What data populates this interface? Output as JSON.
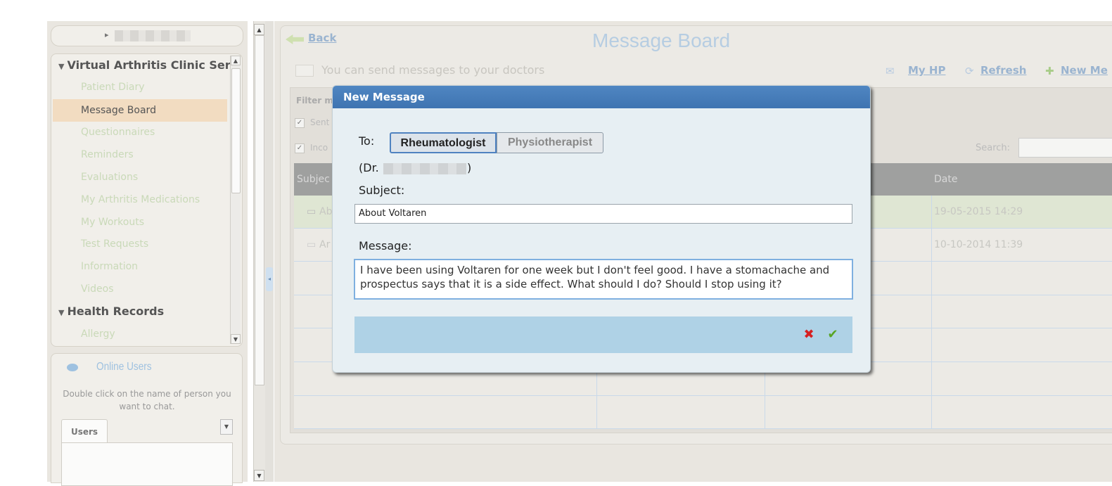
{
  "sidebar": {
    "header_virtual": "Virtual Arthritis Clinic Ser",
    "items": [
      {
        "label": "Patient Diary"
      },
      {
        "label": "Message Board"
      },
      {
        "label": "Questionnaires"
      },
      {
        "label": "Reminders"
      },
      {
        "label": "Evaluations"
      },
      {
        "label": "My Arthritis Medications"
      },
      {
        "label": "My Workouts"
      },
      {
        "label": "Test Requests"
      },
      {
        "label": "Information"
      },
      {
        "label": "Videos"
      }
    ],
    "header_health": "Health Records",
    "health_items": [
      {
        "label": "Allergy"
      }
    ]
  },
  "online_users": {
    "title": "Online Users",
    "description": "Double click on the name of person you want to chat.",
    "tab_label": "Users"
  },
  "main": {
    "back_label": "Back",
    "title": "Message Board",
    "subtitle": "You can send messages to your doctors",
    "links": {
      "my_hp": "My HP",
      "refresh": "Refresh",
      "new_message": "New Me"
    },
    "filter_label": "Filter m",
    "filter_sent": "Sent",
    "filter_incoming": "Inco",
    "search_label": "Search:",
    "table": {
      "headers": [
        "Subjec",
        "Date"
      ],
      "rows": [
        {
          "subject": "Ab",
          "date": "19-05-2015 14:29"
        },
        {
          "subject": "Ar",
          "date": "10-10-2014 11:39"
        }
      ]
    }
  },
  "dialog": {
    "title": "New Message",
    "to_label": "To:",
    "recipients": [
      "Rheumatologist",
      "Physiotherapist"
    ],
    "selected_recipient": "Rheumatologist",
    "dr_prefix": "(Dr.",
    "dr_suffix": ")",
    "subject_label": "Subject:",
    "subject_value": "About Voltaren",
    "message_label": "Message:",
    "message_value": "I have been using Voltaren for one week but I don't feel good. I have a stomachache and prospectus says that it is a side effect. What should I do? Should I stop using it?"
  },
  "colors": {
    "dialog_title_bg": "#4a7fbf",
    "button_bar_bg": "#afd2e6",
    "active_nav_bg": "#f2dcc1",
    "link_color": "#9ab4d0"
  }
}
